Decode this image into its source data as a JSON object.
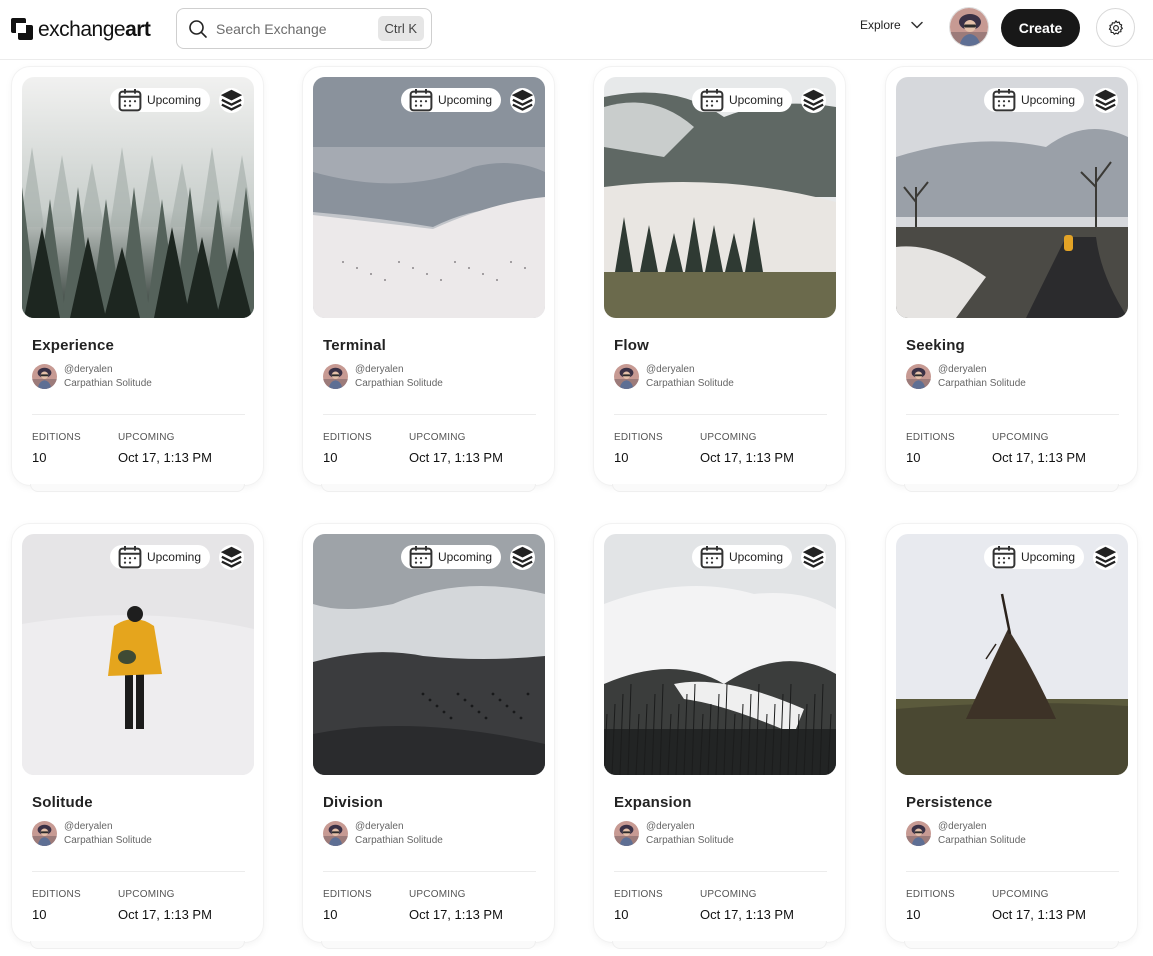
{
  "header": {
    "logo_text_light": "exchange",
    "logo_text_bold": "art",
    "search_placeholder": "Search Exchange",
    "search_shortcut": "Ctrl K",
    "explore_label": "Explore",
    "create_label": "Create"
  },
  "cards": [
    {
      "title": "Experience",
      "badge": "Upcoming",
      "creator_handle": "@deryalen",
      "collection": "Carpathian Solitude",
      "editions_label": "EDITIONS",
      "editions_value": "10",
      "status_label": "UPCOMING",
      "status_value": "Oct 17, 1:13 PM"
    },
    {
      "title": "Terminal",
      "badge": "Upcoming",
      "creator_handle": "@deryalen",
      "collection": "Carpathian Solitude",
      "editions_label": "EDITIONS",
      "editions_value": "10",
      "status_label": "UPCOMING",
      "status_value": "Oct 17, 1:13 PM"
    },
    {
      "title": "Flow",
      "badge": "Upcoming",
      "creator_handle": "@deryalen",
      "collection": "Carpathian Solitude",
      "editions_label": "EDITIONS",
      "editions_value": "10",
      "status_label": "UPCOMING",
      "status_value": "Oct 17, 1:13 PM"
    },
    {
      "title": "Seeking",
      "badge": "Upcoming",
      "creator_handle": "@deryalen",
      "collection": "Carpathian Solitude",
      "editions_label": "EDITIONS",
      "editions_value": "10",
      "status_label": "UPCOMING",
      "status_value": "Oct 17, 1:13 PM"
    },
    {
      "title": "Solitude",
      "badge": "Upcoming",
      "creator_handle": "@deryalen",
      "collection": "Carpathian Solitude",
      "editions_label": "EDITIONS",
      "editions_value": "10",
      "status_label": "UPCOMING",
      "status_value": "Oct 17, 1:13 PM"
    },
    {
      "title": "Division",
      "badge": "Upcoming",
      "creator_handle": "@deryalen",
      "collection": "Carpathian Solitude",
      "editions_label": "EDITIONS",
      "editions_value": "10",
      "status_label": "UPCOMING",
      "status_value": "Oct 17, 1:13 PM"
    },
    {
      "title": "Expansion",
      "badge": "Upcoming",
      "creator_handle": "@deryalen",
      "collection": "Carpathian Solitude",
      "editions_label": "EDITIONS",
      "editions_value": "10",
      "status_label": "UPCOMING",
      "status_value": "Oct 17, 1:13 PM"
    },
    {
      "title": "Persistence",
      "badge": "Upcoming",
      "creator_handle": "@deryalen",
      "collection": "Carpathian Solitude",
      "editions_label": "EDITIONS",
      "editions_value": "10",
      "status_label": "UPCOMING",
      "status_value": "Oct 17, 1:13 PM"
    }
  ],
  "icons": {
    "logo": "exchange-art-logo-icon",
    "search": "search-icon",
    "explore": "chevron-down-icon",
    "settings": "gear-icon",
    "badge": "calendar-icon",
    "edition": "layers-icon"
  },
  "colors": {
    "create_button": "#181818",
    "shortcut_chip": "#e6e6e6"
  }
}
